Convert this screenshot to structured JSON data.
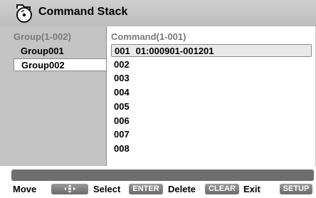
{
  "title": "Command Stack",
  "groups": {
    "header": "Group(1-002)",
    "items": [
      {
        "label": "Group001",
        "selected": false
      },
      {
        "label": "Group002",
        "selected": true
      }
    ]
  },
  "commands": {
    "header": "Command(1-001)",
    "rows": [
      {
        "num": "001",
        "detail": "01:000901-001201",
        "selected": true
      },
      {
        "num": "002",
        "detail": ""
      },
      {
        "num": "003",
        "detail": ""
      },
      {
        "num": "004",
        "detail": ""
      },
      {
        "num": "005",
        "detail": ""
      },
      {
        "num": "006",
        "detail": ""
      },
      {
        "num": "007",
        "detail": ""
      },
      {
        "num": "008",
        "detail": ""
      }
    ]
  },
  "help": {
    "move": "Move",
    "select": "Select",
    "enter_key": "ENTER",
    "delete": "Delete",
    "clear_key": "CLEAR",
    "exit": "Exit",
    "setup_key": "SETUP"
  },
  "icons": {
    "title": "disc-icon",
    "move_key": "arrows-icon"
  }
}
